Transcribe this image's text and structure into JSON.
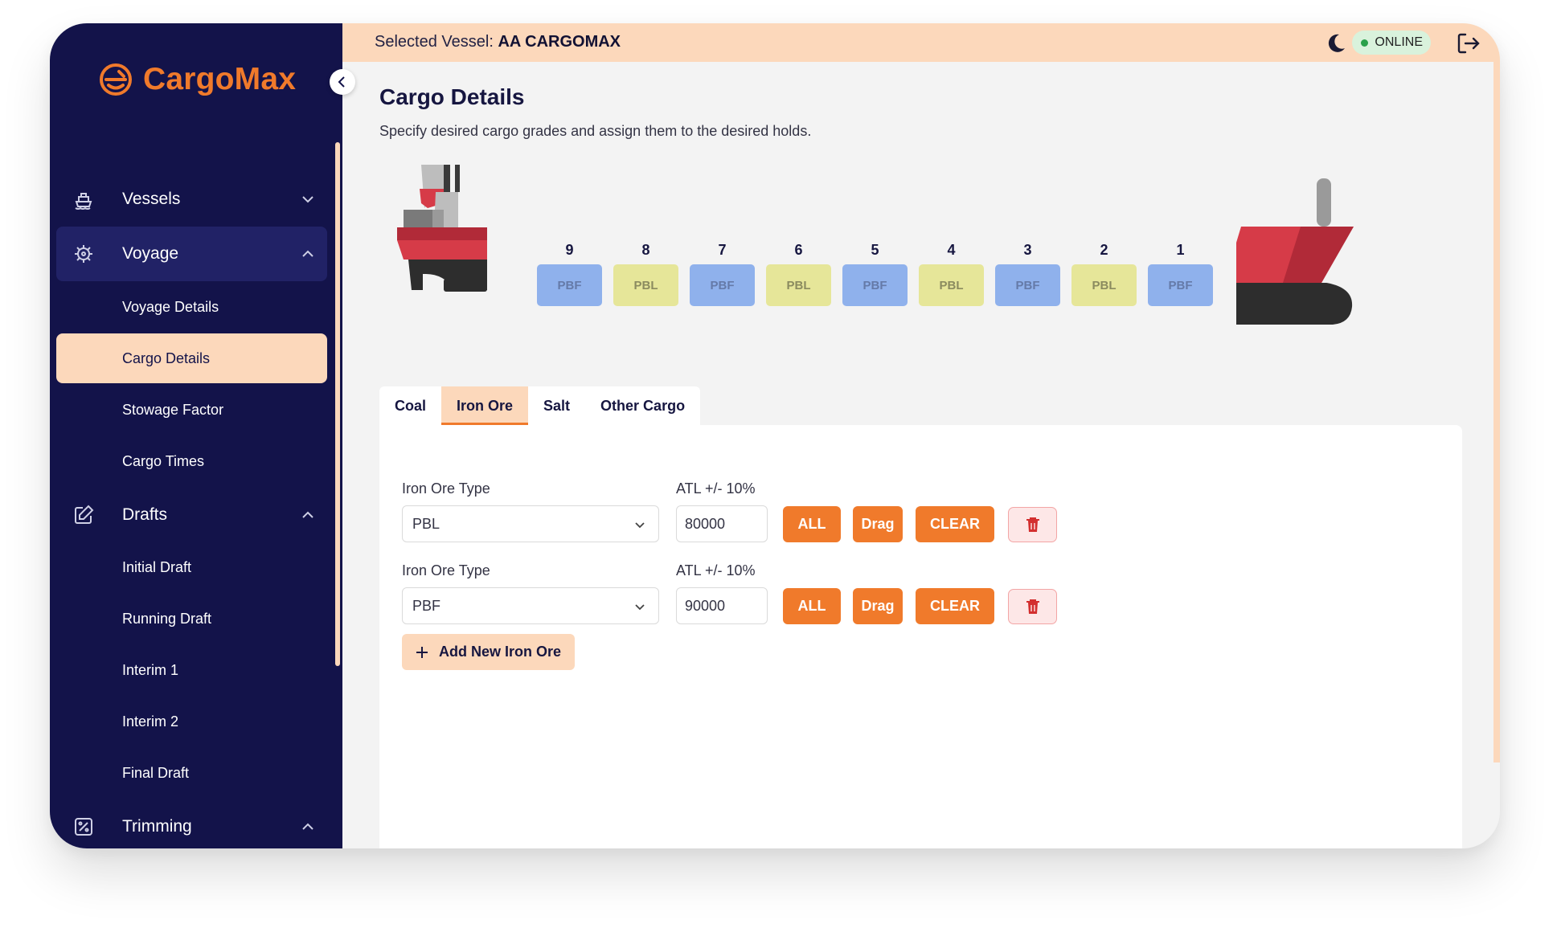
{
  "app": {
    "name": "CargoMax"
  },
  "header": {
    "vessel_prefix": "Selected Vessel:",
    "vessel_name": "AA CARGOMAX",
    "status": "ONLINE"
  },
  "sidebar": {
    "groups": [
      {
        "label": "Vessels",
        "icon": "ship-icon",
        "expanded": false
      },
      {
        "label": "Voyage",
        "icon": "ship-wheel-icon",
        "expanded": true,
        "items": [
          "Voyage Details",
          "Cargo Details",
          "Stowage Factor",
          "Cargo Times"
        ]
      },
      {
        "label": "Drafts",
        "icon": "edit-icon",
        "expanded": true,
        "items": [
          "Initial Draft",
          "Running Draft",
          "Interim 1",
          "Interim 2",
          "Final Draft"
        ]
      },
      {
        "label": "Trimming",
        "icon": "trim-icon",
        "expanded": true
      }
    ],
    "active_item": "Cargo Details"
  },
  "page": {
    "title": "Cargo Details",
    "subtitle": "Specify desired cargo grades and assign them to the desired holds."
  },
  "holds": [
    {
      "number": "9",
      "grade": "PBF"
    },
    {
      "number": "8",
      "grade": "PBL"
    },
    {
      "number": "7",
      "grade": "PBF"
    },
    {
      "number": "6",
      "grade": "PBL"
    },
    {
      "number": "5",
      "grade": "PBF"
    },
    {
      "number": "4",
      "grade": "PBL"
    },
    {
      "number": "3",
      "grade": "PBF"
    },
    {
      "number": "2",
      "grade": "PBL"
    },
    {
      "number": "1",
      "grade": "PBF"
    }
  ],
  "tabs": [
    {
      "label": "Coal",
      "active": false
    },
    {
      "label": "Iron Ore",
      "active": true
    },
    {
      "label": "Salt",
      "active": false
    },
    {
      "label": "Other Cargo",
      "active": false
    }
  ],
  "rows": [
    {
      "type_label": "Iron Ore Type",
      "type_value": "PBL",
      "atl_label": "ATL +/- 10%",
      "atl_value": "80000"
    },
    {
      "type_label": "Iron Ore Type",
      "type_value": "PBF",
      "atl_label": "ATL +/- 10%",
      "atl_value": "90000"
    }
  ],
  "row_buttons": {
    "all": "ALL",
    "drag": "Drag",
    "clear": "CLEAR"
  },
  "add_button": "Add New Iron Ore",
  "colors": {
    "sidebar": "#13134a",
    "accent": "#f07a2b",
    "accent_soft": "#fcd8bb",
    "pbf": "#8fb1ec",
    "pbl": "#e6e699",
    "online": "#29a04a"
  }
}
